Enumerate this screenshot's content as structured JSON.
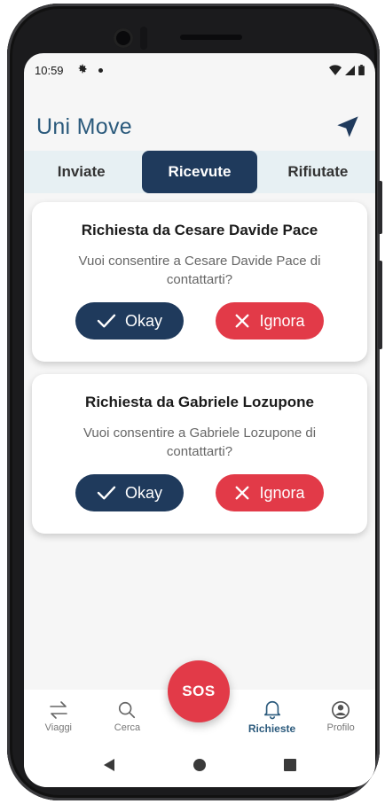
{
  "status_bar": {
    "time": "10:59"
  },
  "app_bar": {
    "title": "Uni Move"
  },
  "tabs": [
    {
      "label": "Inviate",
      "active": false
    },
    {
      "label": "Ricevute",
      "active": true
    },
    {
      "label": "Rifiutate",
      "active": false
    }
  ],
  "requests": [
    {
      "title": "Richiesta da Cesare Davide Pace",
      "message": "Vuoi consentire a Cesare Davide Pace di contattarti?",
      "accept_label": "Okay",
      "ignore_label": "Ignora"
    },
    {
      "title": "Richiesta da Gabriele Lozupone",
      "message": "Vuoi consentire a Gabriele Lozupone di contattarti?",
      "accept_label": "Okay",
      "ignore_label": "Ignora"
    }
  ],
  "sos_label": "SOS",
  "bottom_nav": [
    {
      "label": "Viaggi",
      "icon": "swap-arrows-icon",
      "active": false
    },
    {
      "label": "Cerca",
      "icon": "search-icon",
      "active": false
    },
    {
      "label": "Richieste",
      "icon": "bell-icon",
      "active": true
    },
    {
      "label": "Profilo",
      "icon": "profile-icon",
      "active": false
    }
  ],
  "colors": {
    "primary": "#1f3a5c",
    "title": "#2b5a7c",
    "danger": "#e23a48",
    "tab_background": "#e7f0f3"
  }
}
